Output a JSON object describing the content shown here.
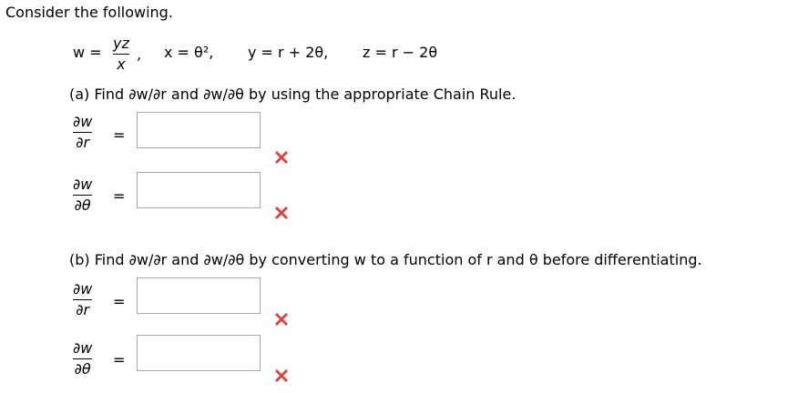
{
  "intro": "Consider the following.",
  "given": {
    "w_lhs": "w =",
    "w_num": "yz",
    "w_den": "x",
    "comma1": ",",
    "x_def": "x = θ²,",
    "y_def": "y = r + 2θ,",
    "z_def": "z = r − 2θ"
  },
  "part_a": {
    "prompt": "(a) Find ∂w/∂r and ∂w/∂θ by using the appropriate Chain Rule.",
    "rows": [
      {
        "num": "∂w",
        "den": "∂r",
        "eq": "=",
        "value": ""
      },
      {
        "num": "∂w",
        "den": "∂θ",
        "eq": "=",
        "value": ""
      }
    ]
  },
  "part_b": {
    "prompt": "(b) Find ∂w/∂r and ∂w/∂θ by converting w to a function of r and θ before differentiating.",
    "rows": [
      {
        "num": "∂w",
        "den": "∂r",
        "eq": "=",
        "value": ""
      },
      {
        "num": "∂w",
        "den": "∂θ",
        "eq": "=",
        "value": ""
      }
    ]
  },
  "colors": {
    "incorrect": "#e0403a",
    "input_border": "#a8a8a8"
  },
  "icons": {
    "incorrect": "x-mark-icon"
  }
}
